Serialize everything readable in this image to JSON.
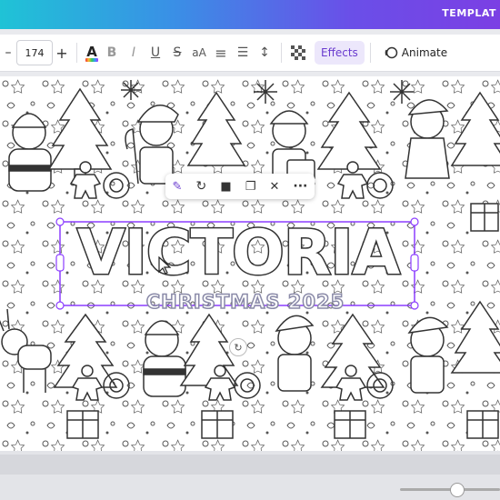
{
  "header": {
    "template_label": "TEMPLAT"
  },
  "toolbar": {
    "minus": "–",
    "font_size": "174",
    "plus": "+",
    "color_glyph": "A",
    "bold_glyph": "B",
    "italic_glyph": "I",
    "underline_glyph": "U",
    "strike_glyph": "S",
    "case_glyph": "aA",
    "align_glyph": "≡",
    "list_glyph": "☰",
    "spacing_glyph": "↕",
    "effects_label": "Effects",
    "animate_label": "Animate"
  },
  "canvas": {
    "title_text": "VICTORIA",
    "subtitle_text": "CHRISTMAS 2025"
  },
  "context_menu": {
    "items": [
      "magic-edit",
      "regenerate",
      "lock",
      "duplicate",
      "delete",
      "more"
    ]
  },
  "colors": {
    "accent": "#7d2ae8",
    "selection": "#8b3dff",
    "effects_bg": "#ece7fb"
  }
}
